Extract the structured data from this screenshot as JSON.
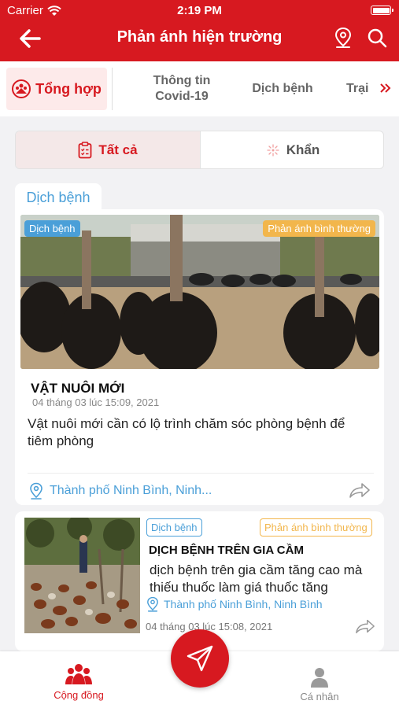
{
  "status_bar": {
    "carrier": "Carrier",
    "time": "2:19 PM"
  },
  "header": {
    "title": "Phản ánh hiện trường",
    "back_icon": "back-arrow-icon",
    "location_icon": "map-pin-icon",
    "search_icon": "search-icon",
    "color": "#d71920"
  },
  "categories": {
    "active": "Tổng hợp",
    "items": [
      "Thông tin Covid-19",
      "Dịch bệnh",
      "Trại"
    ]
  },
  "segment": {
    "all": "Tất cả",
    "urgent": "Khẩn"
  },
  "section_tag": "Dịch bệnh",
  "posts": [
    {
      "category": "Dịch bệnh",
      "type": "Phản ánh bình thường",
      "title": "VẬT NUÔI MỚI",
      "date": "04 tháng 03 lúc 15:09, 2021",
      "description": "Vật nuôi mới cần có lộ trình chăm sóc phòng bệnh để tiêm phòng",
      "location": "Thành phố Ninh Bình, Ninh..."
    },
    {
      "category": "Dịch bệnh",
      "type": "Phản ánh bình thường",
      "title": "DỊCH BỆNH TRÊN GIA CẦM",
      "description": "dịch bệnh trên gia cầm tăng cao mà thiếu thuốc làm giá thuốc tăng",
      "location": "Thành phố Ninh Bình, Ninh Bình",
      "date": "04 tháng 03 lúc 15:08, 2021"
    }
  ],
  "tabbar": {
    "community": "Cộng đồng",
    "me": "Cá nhân",
    "fab_icon": "send-icon"
  },
  "colors": {
    "primary": "#d71920",
    "link": "#4a9fd8",
    "warning": "#f2b64c"
  }
}
